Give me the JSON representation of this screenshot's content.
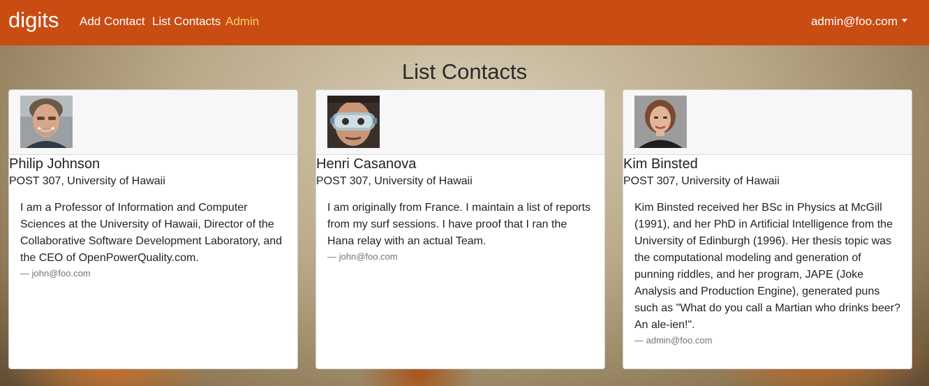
{
  "navbar": {
    "brand": "digits",
    "links": [
      {
        "label": "Add Contact",
        "active": false
      },
      {
        "label": "List Contacts",
        "active": false
      },
      {
        "label": "Admin",
        "active": true
      }
    ],
    "user": "admin@foo.com",
    "background_color": "#c94c13",
    "active_link_color": "#f4d35e"
  },
  "page": {
    "title": "List Contacts"
  },
  "contacts": [
    {
      "name": "Philip Johnson",
      "address": "POST 307, University of Hawaii",
      "description": "I am a Professor of Information and Computer Sciences at the University of Hawaii, Director of the Collaborative Software Development Laboratory, and the CEO of OpenPowerQuality.com.",
      "owner": "— john@foo.com",
      "avatar": "philip-johnson-photo"
    },
    {
      "name": "Henri Casanova",
      "address": "POST 307, University of Hawaii",
      "description": "I am originally from France. I maintain a list of reports from my surf sessions. I have proof that I ran the Hana relay with an actual Team.",
      "owner": "— john@foo.com",
      "avatar": "henri-casanova-photo"
    },
    {
      "name": "Kim Binsted",
      "address": "POST 307, University of Hawaii",
      "description": "Kim Binsted received her BSc in Physics at McGill (1991), and her PhD in Artificial Intelligence from the University of Edinburgh (1996). Her thesis topic was the computational modeling and generation of punning riddles, and her program, JAPE (Joke Analysis and Production Engine), generated puns such as \"What do you call a Martian who drinks beer? An ale-ien!\".",
      "owner": "— admin@foo.com",
      "avatar": "kim-binsted-photo"
    }
  ]
}
